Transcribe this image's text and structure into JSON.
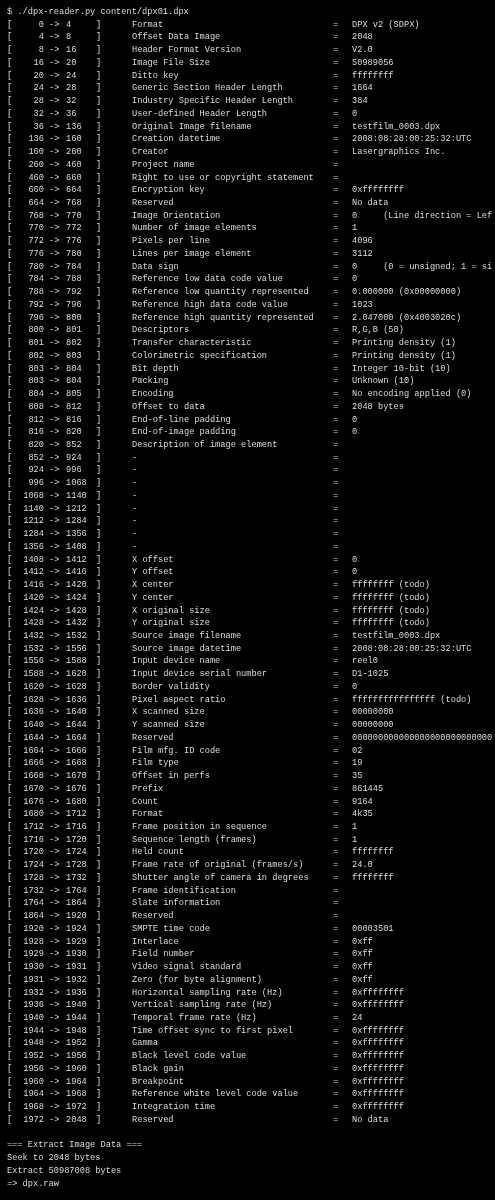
{
  "command": "$ ./dpx-reader.py content/dpx01.dpx",
  "rows": [
    {
      "open": "[",
      "start": "0",
      "arrow": "->",
      "end": "4",
      "close": "]",
      "field": "Format",
      "eq": "=",
      "value": "DPX v2 (SDPX)"
    },
    {
      "open": "[",
      "start": "4",
      "arrow": "->",
      "end": "8",
      "close": "]",
      "field": "Offset Data Image",
      "eq": "=",
      "value": "2048"
    },
    {
      "open": "[",
      "start": "8",
      "arrow": "->",
      "end": "16",
      "close": "]",
      "field": "Header Format Version",
      "eq": "=",
      "value": "V2.0"
    },
    {
      "open": "[",
      "start": "16",
      "arrow": "->",
      "end": "20",
      "close": "]",
      "field": "Image File Size",
      "eq": "=",
      "value": "50989056"
    },
    {
      "open": "[",
      "start": "20",
      "arrow": "->",
      "end": "24",
      "close": "]",
      "field": "Ditto key",
      "eq": "=",
      "value": "ffffffff"
    },
    {
      "open": "[",
      "start": "24",
      "arrow": "->",
      "end": "28",
      "close": "]",
      "field": "Generic Section Header Length",
      "eq": "=",
      "value": "1664"
    },
    {
      "open": "[",
      "start": "28",
      "arrow": "->",
      "end": "32",
      "close": "]",
      "field": "Industry Specific Header Length",
      "eq": "=",
      "value": "384"
    },
    {
      "open": "[",
      "start": "32",
      "arrow": "->",
      "end": "36",
      "close": "]",
      "field": "User-defined Header Length",
      "eq": "=",
      "value": "0"
    },
    {
      "open": "[",
      "start": "36",
      "arrow": "->",
      "end": "136",
      "close": "]",
      "field": "Original Image filename",
      "eq": "=",
      "value": "testfilm_0003.dpx"
    },
    {
      "open": "[",
      "start": "136",
      "arrow": "->",
      "end": "160",
      "close": "]",
      "field": "Creation datetime",
      "eq": "=",
      "value": "2008:08:28:00:25:32:UTC"
    },
    {
      "open": "[",
      "start": "160",
      "arrow": "->",
      "end": "260",
      "close": "]",
      "field": "Creator",
      "eq": "=",
      "value": "Lasergraphics Inc."
    },
    {
      "open": "[",
      "start": "260",
      "arrow": "->",
      "end": "460",
      "close": "]",
      "field": "Project name",
      "eq": "="
    },
    {
      "open": "[",
      "start": "460",
      "arrow": "->",
      "end": "660",
      "close": "]",
      "field": "Right to use or copyright statement",
      "eq": "="
    },
    {
      "open": "[",
      "start": "660",
      "arrow": "->",
      "end": "664",
      "close": "]",
      "field": "Encryption key",
      "eq": "=",
      "value": "0xffffffff"
    },
    {
      "open": "[",
      "start": "664",
      "arrow": "->",
      "end": "768",
      "close": "]",
      "field": "Reserved",
      "eq": "=",
      "value": "No data"
    },
    {
      "open": "[",
      "start": "768",
      "arrow": "->",
      "end": "770",
      "close": "]",
      "field": "Image Orientation",
      "eq": "=",
      "value": "0     (Line direction = Lef"
    },
    {
      "open": "[",
      "start": "770",
      "arrow": "->",
      "end": "772",
      "close": "]",
      "field": "Number of image elements",
      "eq": "=",
      "value": "1"
    },
    {
      "open": "[",
      "start": "772",
      "arrow": "->",
      "end": "776",
      "close": "]",
      "field": "Pixels per line",
      "eq": "=",
      "value": "4096"
    },
    {
      "open": "[",
      "start": "776",
      "arrow": "->",
      "end": "780",
      "close": "]",
      "field": "Lines per image element",
      "eq": "=",
      "value": "3112"
    },
    {
      "open": "[",
      "start": "780",
      "arrow": "->",
      "end": "784",
      "close": "]",
      "field": "Data sign",
      "eq": "=",
      "value": "0     (0 = unsigned; 1 = si"
    },
    {
      "open": "[",
      "start": "784",
      "arrow": "->",
      "end": "788",
      "close": "]",
      "field": "Reference low data code value",
      "eq": "=",
      "value": "0"
    },
    {
      "open": "[",
      "start": "788",
      "arrow": "->",
      "end": "792",
      "close": "]",
      "field": "Reference low quantity represented",
      "eq": "=",
      "value": "0.000000 (0x00000000)"
    },
    {
      "open": "[",
      "start": "792",
      "arrow": "->",
      "end": "796",
      "close": "]",
      "field": "Reference high data code value",
      "eq": "=",
      "value": "1023"
    },
    {
      "open": "[",
      "start": "796",
      "arrow": "->",
      "end": "800",
      "close": "]",
      "field": "Reference high quantity represented",
      "eq": "=",
      "value": "2.047000 (0x4003020c)"
    },
    {
      "open": "[",
      "start": "800",
      "arrow": "->",
      "end": "801",
      "close": "]",
      "field": "Descriptors",
      "eq": "=",
      "value": "R,G,B (50)"
    },
    {
      "open": "[",
      "start": "801",
      "arrow": "->",
      "end": "802",
      "close": "]",
      "field": "Transfer characteristic",
      "eq": "=",
      "value": "Printing density (1)"
    },
    {
      "open": "[",
      "start": "802",
      "arrow": "->",
      "end": "803",
      "close": "]",
      "field": "Colorimetric specification",
      "eq": "=",
      "value": "Printing density (1)"
    },
    {
      "open": "[",
      "start": "803",
      "arrow": "->",
      "end": "804",
      "close": "]",
      "field": "Bit depth",
      "eq": "=",
      "value": "Integer 10-bit (10)"
    },
    {
      "open": "[",
      "start": "803",
      "arrow": "->",
      "end": "804",
      "close": "]",
      "field": "Packing",
      "eq": "=",
      "value": "Unknown (10)"
    },
    {
      "open": "[",
      "start": "804",
      "arrow": "->",
      "end": "805",
      "close": "]",
      "field": "Encoding",
      "eq": "=",
      "value": "No encoding applied (0)"
    },
    {
      "open": "[",
      "start": "808",
      "arrow": "->",
      "end": "812",
      "close": "]",
      "field": "Offset to data",
      "eq": "=",
      "value": "2048 bytes"
    },
    {
      "open": "[",
      "start": "812",
      "arrow": "->",
      "end": "816",
      "close": "]",
      "field": "End-of-line padding",
      "eq": "=",
      "value": "0"
    },
    {
      "open": "[",
      "start": "816",
      "arrow": "->",
      "end": "820",
      "close": "]",
      "field": "End-of-image padding",
      "eq": "=",
      "value": "0"
    },
    {
      "open": "[",
      "start": "820",
      "arrow": "->",
      "end": "852",
      "close": "]",
      "field": "Description of image element",
      "eq": "="
    },
    {
      "open": "[",
      "start": "852",
      "arrow": "->",
      "end": "924",
      "close": "]",
      "field": "-",
      "eq": "="
    },
    {
      "open": "[",
      "start": "924",
      "arrow": "->",
      "end": "996",
      "close": "]",
      "field": "-",
      "eq": "="
    },
    {
      "open": "[",
      "start": "996",
      "arrow": "->",
      "end": "1068",
      "close": "]",
      "field": "-",
      "eq": "="
    },
    {
      "open": "[",
      "start": "1068",
      "arrow": "->",
      "end": "1140",
      "close": "]",
      "field": "-",
      "eq": "="
    },
    {
      "open": "[",
      "start": "1140",
      "arrow": "->",
      "end": "1212",
      "close": "]",
      "field": "-",
      "eq": "="
    },
    {
      "open": "[",
      "start": "1212",
      "arrow": "->",
      "end": "1284",
      "close": "]",
      "field": "-",
      "eq": "="
    },
    {
      "open": "[",
      "start": "1284",
      "arrow": "->",
      "end": "1356",
      "close": "]",
      "field": "-",
      "eq": "="
    },
    {
      "open": "[",
      "start": "1356",
      "arrow": "->",
      "end": "1408",
      "close": "]",
      "field": "-",
      "eq": "="
    },
    {
      "open": "[",
      "start": "1408",
      "arrow": "->",
      "end": "1412",
      "close": "]",
      "field": "X offset",
      "eq": "=",
      "value": "0"
    },
    {
      "open": "[",
      "start": "1412",
      "arrow": "->",
      "end": "1416",
      "close": "]",
      "field": "Y offset",
      "eq": "=",
      "value": "0"
    },
    {
      "open": "[",
      "start": "1416",
      "arrow": "->",
      "end": "1420",
      "close": "]",
      "field": "X center",
      "eq": "=",
      "value": "ffffffff (todo)"
    },
    {
      "open": "[",
      "start": "1420",
      "arrow": "->",
      "end": "1424",
      "close": "]",
      "field": "Y center",
      "eq": "=",
      "value": "ffffffff (todo)"
    },
    {
      "open": "[",
      "start": "1424",
      "arrow": "->",
      "end": "1428",
      "close": "]",
      "field": "X original size",
      "eq": "=",
      "value": "ffffffff (todo)"
    },
    {
      "open": "[",
      "start": "1428",
      "arrow": "->",
      "end": "1432",
      "close": "]",
      "field": "Y original size",
      "eq": "=",
      "value": "ffffffff (todo)"
    },
    {
      "open": "[",
      "start": "1432",
      "arrow": "->",
      "end": "1532",
      "close": "]",
      "field": "Source image filename",
      "eq": "=",
      "value": "testfilm_0003.dpx"
    },
    {
      "open": "[",
      "start": "1532",
      "arrow": "->",
      "end": "1556",
      "close": "]",
      "field": "Source image datetime",
      "eq": "=",
      "value": "2008:08:28:00:25:32:UTC"
    },
    {
      "open": "[",
      "start": "1556",
      "arrow": "->",
      "end": "1588",
      "close": "]",
      "field": "Input device name",
      "eq": "=",
      "value": "reel0"
    },
    {
      "open": "[",
      "start": "1588",
      "arrow": "->",
      "end": "1620",
      "close": "]",
      "field": "Input device serial number",
      "eq": "=",
      "value": "D1-1025"
    },
    {
      "open": "[",
      "start": "1620",
      "arrow": "->",
      "end": "1628",
      "close": "]",
      "field": "Border validity",
      "eq": "=",
      "value": "0"
    },
    {
      "open": "[",
      "start": "1628",
      "arrow": "->",
      "end": "1636",
      "close": "]",
      "field": "Pixel aspect ratio",
      "eq": "=",
      "value": "ffffffffffffffff (todo)"
    },
    {
      "open": "[",
      "start": "1636",
      "arrow": "->",
      "end": "1640",
      "close": "]",
      "field": "X scanned size",
      "eq": "=",
      "value": "00000000"
    },
    {
      "open": "[",
      "start": "1640",
      "arrow": "->",
      "end": "1644",
      "close": "]",
      "field": "Y scanned size",
      "eq": "=",
      "value": "00000000"
    },
    {
      "open": "[",
      "start": "1644",
      "arrow": "->",
      "end": "1664",
      "close": "]",
      "field": "Reserved",
      "eq": "=",
      "value": "000000000000000000000000000"
    },
    {
      "open": "[",
      "start": "1664",
      "arrow": "->",
      "end": "1666",
      "close": "]",
      "field": "Film mfg. ID code",
      "eq": "=",
      "value": "02"
    },
    {
      "open": "[",
      "start": "1666",
      "arrow": "->",
      "end": "1668",
      "close": "]",
      "field": "Film type",
      "eq": "=",
      "value": "19"
    },
    {
      "open": "[",
      "start": "1668",
      "arrow": "->",
      "end": "1670",
      "close": "]",
      "field": "Offset in perfs",
      "eq": "=",
      "value": "35"
    },
    {
      "open": "[",
      "start": "1670",
      "arrow": "->",
      "end": "1676",
      "close": "]",
      "field": "Prefix",
      "eq": "=",
      "value": "861445"
    },
    {
      "open": "[",
      "start": "1676",
      "arrow": "->",
      "end": "1680",
      "close": "]",
      "field": "Count",
      "eq": "=",
      "value": "9164"
    },
    {
      "open": "[",
      "start": "1680",
      "arrow": "->",
      "end": "1712",
      "close": "]",
      "field": "Format",
      "eq": "=",
      "value": "4k35"
    },
    {
      "open": "[",
      "start": "1712",
      "arrow": "->",
      "end": "1716",
      "close": "]",
      "field": "Frame position in sequence",
      "eq": "=",
      "value": "1"
    },
    {
      "open": "[",
      "start": "1716",
      "arrow": "->",
      "end": "1720",
      "close": "]",
      "field": "Sequence length (frames)",
      "eq": "=",
      "value": "1"
    },
    {
      "open": "[",
      "start": "1720",
      "arrow": "->",
      "end": "1724",
      "close": "]",
      "field": "Held count",
      "eq": "=",
      "value": "ffffffff"
    },
    {
      "open": "[",
      "start": "1724",
      "arrow": "->",
      "end": "1728",
      "close": "]",
      "field": "Frame rate of original (frames/s)",
      "eq": "=",
      "value": "24.0"
    },
    {
      "open": "[",
      "start": "1728",
      "arrow": "->",
      "end": "1732",
      "close": "]",
      "field": "Shutter angle of camera in degrees",
      "eq": "=",
      "value": "ffffffff"
    },
    {
      "open": "[",
      "start": "1732",
      "arrow": "->",
      "end": "1764",
      "close": "]",
      "field": "Frame identification",
      "eq": "="
    },
    {
      "open": "[",
      "start": "1764",
      "arrow": "->",
      "end": "1864",
      "close": "]",
      "field": "Slate information",
      "eq": "="
    },
    {
      "open": "[",
      "start": "1864",
      "arrow": "->",
      "end": "1920",
      "close": "]",
      "field": "Reserved",
      "eq": "="
    },
    {
      "open": "[",
      "start": "1920",
      "arrow": "->",
      "end": "1924",
      "close": "]",
      "field": "SMPTE time code",
      "eq": "=",
      "value": "00003501"
    },
    {
      "open": "[",
      "start": "1928",
      "arrow": "->",
      "end": "1929",
      "close": "]",
      "field": "Interlace",
      "eq": "=",
      "value": "0xff"
    },
    {
      "open": "[",
      "start": "1929",
      "arrow": "->",
      "end": "1930",
      "close": "]",
      "field": "Field number",
      "eq": "=",
      "value": "0xff"
    },
    {
      "open": "[",
      "start": "1930",
      "arrow": "->",
      "end": "1931",
      "close": "]",
      "field": "Video signal standard",
      "eq": "=",
      "value": "0xff"
    },
    {
      "open": "[",
      "start": "1931",
      "arrow": "->",
      "end": "1932",
      "close": "]",
      "field": "Zero (for byte alignment)",
      "eq": "=",
      "value": "0xff"
    },
    {
      "open": "[",
      "start": "1932",
      "arrow": "->",
      "end": "1936",
      "close": "]",
      "field": "Horizontal sampling rate (Hz)",
      "eq": "=",
      "value": "0xffffffff"
    },
    {
      "open": "[",
      "start": "1936",
      "arrow": "->",
      "end": "1940",
      "close": "]",
      "field": "Vertical sampling rate (Hz)",
      "eq": "=",
      "value": "0xffffffff"
    },
    {
      "open": "[",
      "start": "1940",
      "arrow": "->",
      "end": "1944",
      "close": "]",
      "field": "Temporal frame rate (Hz)",
      "eq": "=",
      "value": "24"
    },
    {
      "open": "[",
      "start": "1944",
      "arrow": "->",
      "end": "1948",
      "close": "]",
      "field": "Time offset sync to first pixel",
      "eq": "=",
      "value": "0xffffffff"
    },
    {
      "open": "[",
      "start": "1948",
      "arrow": "->",
      "end": "1952",
      "close": "]",
      "field": "Gamma",
      "eq": "=",
      "value": "0xffffffff"
    },
    {
      "open": "[",
      "start": "1952",
      "arrow": "->",
      "end": "1956",
      "close": "]",
      "field": "Black level code value",
      "eq": "=",
      "value": "0xffffffff"
    },
    {
      "open": "[",
      "start": "1956",
      "arrow": "->",
      "end": "1960",
      "close": "]",
      "field": "Black gain",
      "eq": "=",
      "value": "0xffffffff"
    },
    {
      "open": "[",
      "start": "1960",
      "arrow": "->",
      "end": "1964",
      "close": "]",
      "field": "Breakpoint",
      "eq": "=",
      "value": "0xffffffff"
    },
    {
      "open": "[",
      "start": "1964",
      "arrow": "->",
      "end": "1968",
      "close": "]",
      "field": "Reference white level code value",
      "eq": "=",
      "value": "0xffffffff"
    },
    {
      "open": "[",
      "start": "1968",
      "arrow": "->",
      "end": "1972",
      "close": "]",
      "field": "Integration time",
      "eq": "=",
      "value": "0xffffffff"
    },
    {
      "open": "[",
      "start": "1972",
      "arrow": "->",
      "end": "2048",
      "close": "]",
      "field": "Reserved",
      "eq": "=",
      "value": "No data"
    }
  ],
  "footer": [
    "=== Extract Image Data ===",
    "Seek to 2048 bytes",
    "Extract 50987008 bytes",
    "=> dpx.raw"
  ]
}
